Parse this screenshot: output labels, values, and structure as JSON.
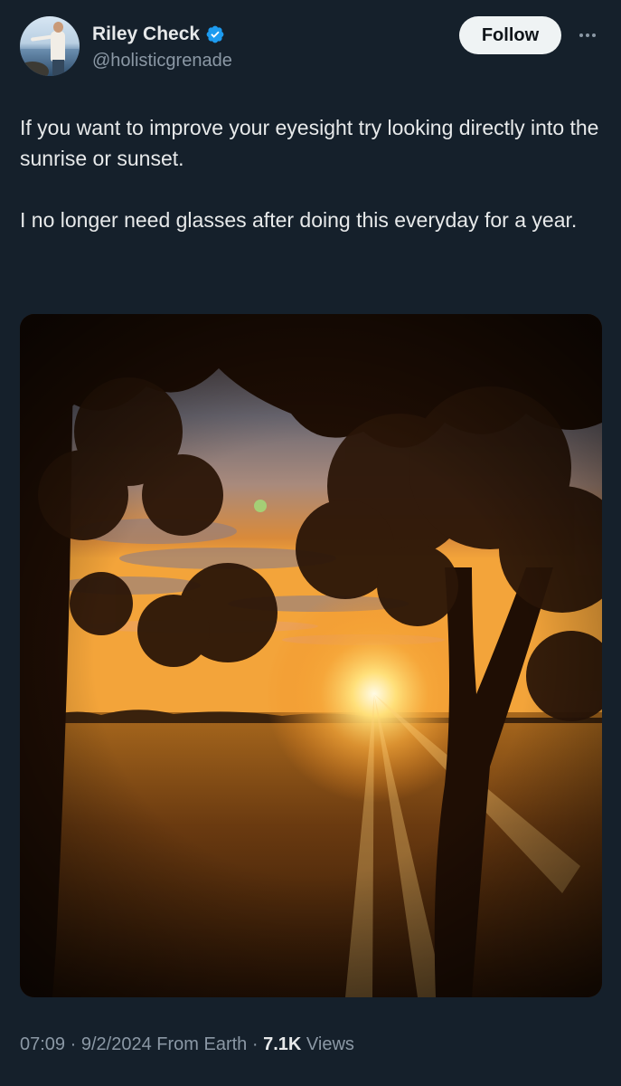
{
  "author": {
    "display_name": "Riley Check",
    "handle": "@holisticgrenade",
    "verified": true,
    "verified_color": "#1d9bf0",
    "avatar_icon": "profile-photo-man-by-sea"
  },
  "actions": {
    "follow_label": "Follow",
    "more_icon": "ellipsis-icon"
  },
  "tweet": {
    "paragraphs": [
      "If you want to improve your eyesight try looking directly into the sunrise or sunset.",
      "I no longer need glasses after doing this everyday for a year."
    ]
  },
  "media": {
    "subject": "photo-sunset-through-trees-over-field"
  },
  "meta": {
    "time": "07:09",
    "sep1": "·",
    "date": "9/2/2024",
    "source": "From Earth",
    "sep2": "·",
    "views_count": "7.1K",
    "views_label": "Views"
  },
  "colors": {
    "background": "#15202b",
    "text_primary": "#e7e9ea",
    "text_secondary": "#8b98a5",
    "button_bg": "#eff3f4"
  }
}
